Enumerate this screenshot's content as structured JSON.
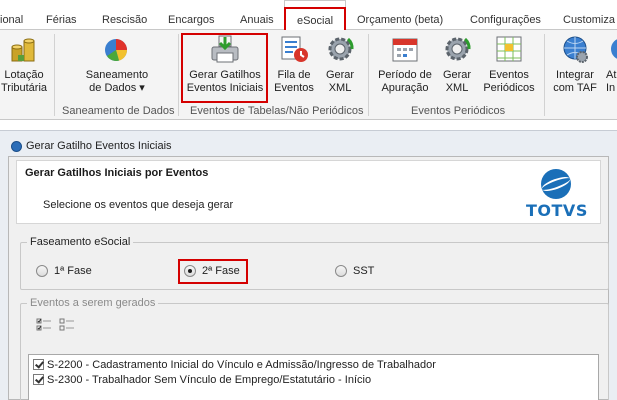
{
  "tabs": [
    {
      "label": "ional"
    },
    {
      "label": "Férias"
    },
    {
      "label": "Rescisão"
    },
    {
      "label": "Encargos"
    },
    {
      "label": "Anuais"
    },
    {
      "label": "eSocial"
    },
    {
      "label": "Orçamento (beta)"
    },
    {
      "label": "Configurações"
    },
    {
      "label": "Customiza"
    }
  ],
  "ribbon": {
    "buttons": [
      {
        "line1": "Lotação",
        "line2": "Tributária",
        "icon": "coins-icon"
      },
      {
        "line1": "Saneamento",
        "line2": "de Dados ▾",
        "icon": "pie-chart-icon"
      },
      {
        "line1": "Gerar Gatilhos",
        "line2": "Eventos Iniciais",
        "icon": "printer-download-icon"
      },
      {
        "line1": "Fila de",
        "line2": "Eventos",
        "icon": "queue-icon"
      },
      {
        "line1": "Gerar",
        "line2": "XML",
        "icon": "gear-refresh-icon"
      },
      {
        "line1": "Período de",
        "line2": "Apuração",
        "icon": "calendar-icon"
      },
      {
        "line1": "Gerar",
        "line2": "XML",
        "icon": "gear-refresh-icon"
      },
      {
        "line1": "Eventos",
        "line2": "Periódicos",
        "icon": "spreadsheet-icon"
      },
      {
        "line1": "Integrar",
        "line2": "com TAF",
        "icon": "globe-gear-icon"
      },
      {
        "line1": "At",
        "line2": "In",
        "icon": "partial-icon"
      }
    ],
    "groups": [
      "Saneamento de Dados",
      "Eventos de Tabelas/Não Periódicos",
      "Eventos Periódicos"
    ]
  },
  "window": {
    "title": "Gerar Gatilho Eventos Iniciais",
    "header_title": "Gerar Gatilhos Iniciais por Eventos",
    "header_subtitle": "Selecione os eventos que deseja gerar",
    "logo_text": "TOTVS"
  },
  "faseamento": {
    "legend": "Faseamento eSocial",
    "options": [
      "1ª Fase",
      "2ª Fase",
      "SST"
    ],
    "selected": "2ª Fase"
  },
  "eventos": {
    "legend": "Eventos a serem gerados",
    "items": [
      {
        "label": "S-2200 - Cadastramento Inicial do Vínculo e Admissão/Ingresso de Trabalhador",
        "checked": true
      },
      {
        "label": "S-2300 - Trabalhador Sem Vínculo de Emprego/Estatutário - Início",
        "checked": true
      }
    ]
  },
  "colors": {
    "highlight": "#d40000",
    "brand": "#1a6fb8"
  }
}
